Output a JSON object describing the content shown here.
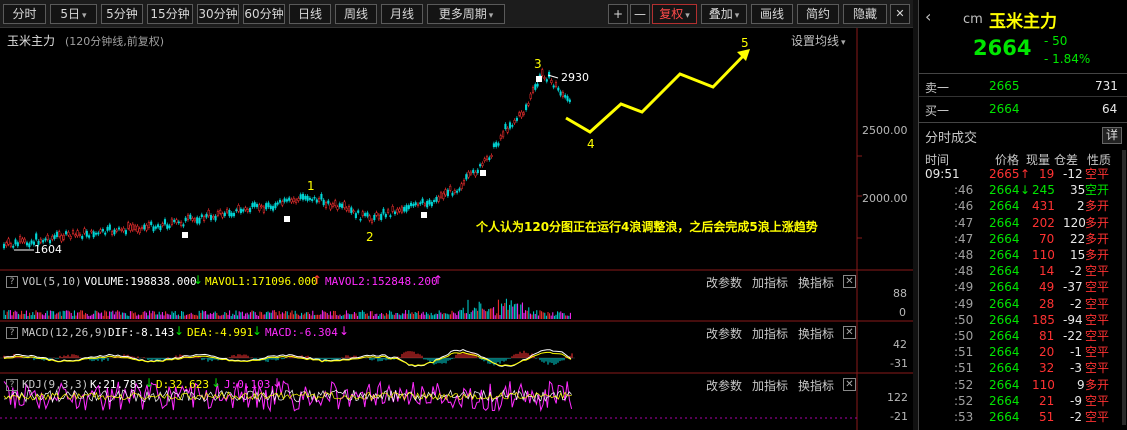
{
  "toolbar": {
    "periods": [
      "分时",
      "5日",
      "5分钟",
      "15分钟",
      "30分钟",
      "60分钟",
      "日线",
      "周线",
      "月线",
      "更多周期"
    ],
    "plus": "+",
    "minus": "—",
    "fuquan": "复权",
    "diejia": "叠加",
    "huaxian": "画线",
    "jianyue": "简约",
    "yincang": "隐藏",
    "close": "✕"
  },
  "chart": {
    "title": "玉米主力",
    "subtitle": "(120分钟线,前复权)",
    "settings": "设置均线",
    "annotation": "个人认为120分图正在运行4浪调整浪，之后会完成5浪上涨趋势",
    "wave_labels": [
      "1",
      "2",
      "3",
      "4",
      "5"
    ],
    "high_label": "2930",
    "low_label": "1604",
    "y_ticks": [
      "2500.00",
      "2000.00"
    ]
  },
  "panels": {
    "vol": {
      "name": "VOL(5,10)",
      "v1": "VOLUME:198838.000",
      "v2": "MAVOL1:171096.000",
      "v3": "MAVOL2:152848.200",
      "ticks": [
        "88",
        "0"
      ]
    },
    "macd": {
      "name": "MACD(12,26,9)",
      "v1": "DIF:-8.143",
      "v2": "DEA:-4.991",
      "v3": "MACD:-6.304",
      "ticks": [
        "42",
        "-31"
      ]
    },
    "kdj": {
      "name": "KDJ(9,3,3)",
      "v1": "K:21.783",
      "v2": "D:32.623",
      "v3": "J:0.103",
      "ticks": [
        "122",
        "-21"
      ]
    },
    "btn_params": "改参数",
    "btn_add": "加指标",
    "btn_switch": "换指标",
    "close": "✕",
    "q": "?"
  },
  "quote": {
    "exchange": "cm",
    "name": "玉米主力",
    "price": "2664",
    "change": "- 50",
    "pct": "- 1.84%",
    "sell_label": "卖一",
    "sell_price": "2665",
    "sell_vol": "731",
    "buy_label": "买一",
    "buy_price": "2664",
    "buy_vol": "64"
  },
  "trades": {
    "title": "分时成交",
    "detail": "详",
    "headers": [
      "时间",
      "价格",
      "现量",
      "仓差",
      "性质"
    ],
    "rows": [
      {
        "time": "09:51",
        "price": "2665",
        "arrow": "↑",
        "vol": "19",
        "pos": "-12",
        "type": "空平"
      },
      {
        "time": ":46",
        "price": "2664",
        "arrow": "↓",
        "vol": "245",
        "pos": "35",
        "type": "空开"
      },
      {
        "time": ":46",
        "price": "2664",
        "arrow": "",
        "vol": "431",
        "pos": "2",
        "type": "多开"
      },
      {
        "time": ":47",
        "price": "2664",
        "arrow": "",
        "vol": "202",
        "pos": "120",
        "type": "多开"
      },
      {
        "time": ":47",
        "price": "2664",
        "arrow": "",
        "vol": "70",
        "pos": "22",
        "type": "多开"
      },
      {
        "time": ":48",
        "price": "2664",
        "arrow": "",
        "vol": "110",
        "pos": "15",
        "type": "多开"
      },
      {
        "time": ":48",
        "price": "2664",
        "arrow": "",
        "vol": "14",
        "pos": "-2",
        "type": "空平"
      },
      {
        "time": ":49",
        "price": "2664",
        "arrow": "",
        "vol": "49",
        "pos": "-37",
        "type": "空平"
      },
      {
        "time": ":49",
        "price": "2664",
        "arrow": "",
        "vol": "28",
        "pos": "-2",
        "type": "空平"
      },
      {
        "time": ":50",
        "price": "2664",
        "arrow": "",
        "vol": "185",
        "pos": "-94",
        "type": "空平"
      },
      {
        "time": ":50",
        "price": "2664",
        "arrow": "",
        "vol": "81",
        "pos": "-22",
        "type": "空平"
      },
      {
        "time": ":51",
        "price": "2664",
        "arrow": "",
        "vol": "20",
        "pos": "-1",
        "type": "空平"
      },
      {
        "time": ":51",
        "price": "2664",
        "arrow": "",
        "vol": "32",
        "pos": "-3",
        "type": "空平"
      },
      {
        "time": ":52",
        "price": "2664",
        "arrow": "",
        "vol": "110",
        "pos": "9",
        "type": "多开"
      },
      {
        "time": ":52",
        "price": "2664",
        "arrow": "",
        "vol": "21",
        "pos": "-9",
        "type": "空平"
      },
      {
        "time": ":53",
        "price": "2664",
        "arrow": "",
        "vol": "51",
        "pos": "-2",
        "type": "空平"
      }
    ]
  },
  "colors": {
    "up": "#ff3232",
    "down": "#00e600",
    "yellow": "#ffff00",
    "cyan": "#00d7d7",
    "magenta": "#ff2bff",
    "white": "#ffffff"
  }
}
